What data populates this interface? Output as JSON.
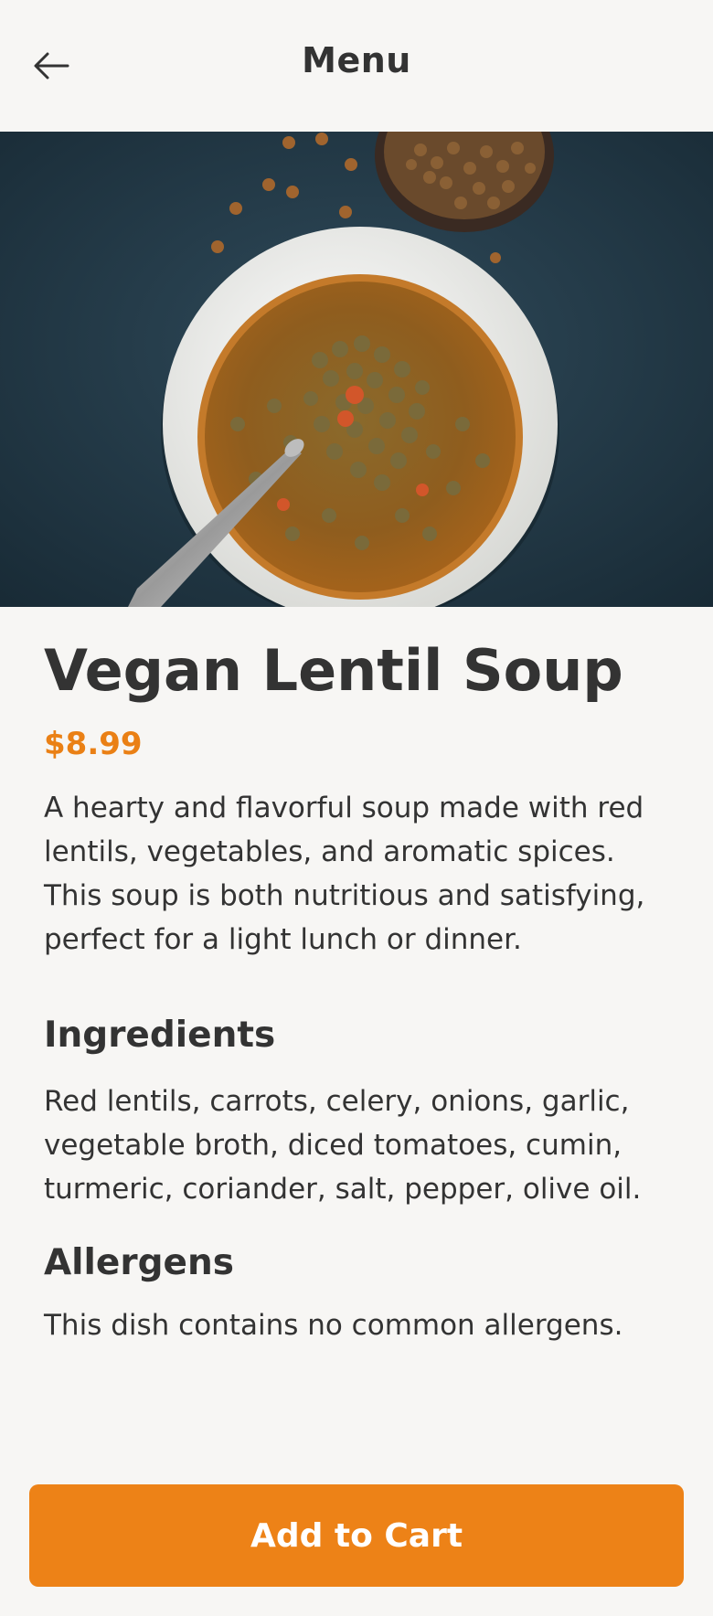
{
  "header": {
    "title": "Menu",
    "back_icon": "arrow-left-icon"
  },
  "hero": {
    "image": "lentil-soup-photo"
  },
  "dish": {
    "name": "Vegan Lentil Soup",
    "price": "$8.99",
    "description": "A hearty and flavorful soup made with red lentils, vegetables, and aromatic spices. This soup is both nutritious and satisfying, perfect for a light lunch or dinner."
  },
  "ingredients": {
    "heading": "Ingredients",
    "text": "Red lentils, carrots, celery, onions, garlic, vegetable broth, diced tomatoes, cumin, turmeric, coriander, salt, pepper, olive oil."
  },
  "allergens": {
    "heading": "Allergens",
    "text": "This dish contains no common allergens."
  },
  "actions": {
    "add_to_cart_label": "Add to Cart"
  },
  "colors": {
    "accent": "#ED8217",
    "price": "#EA8015",
    "text": "#333333",
    "background": "#F7F6F4"
  }
}
